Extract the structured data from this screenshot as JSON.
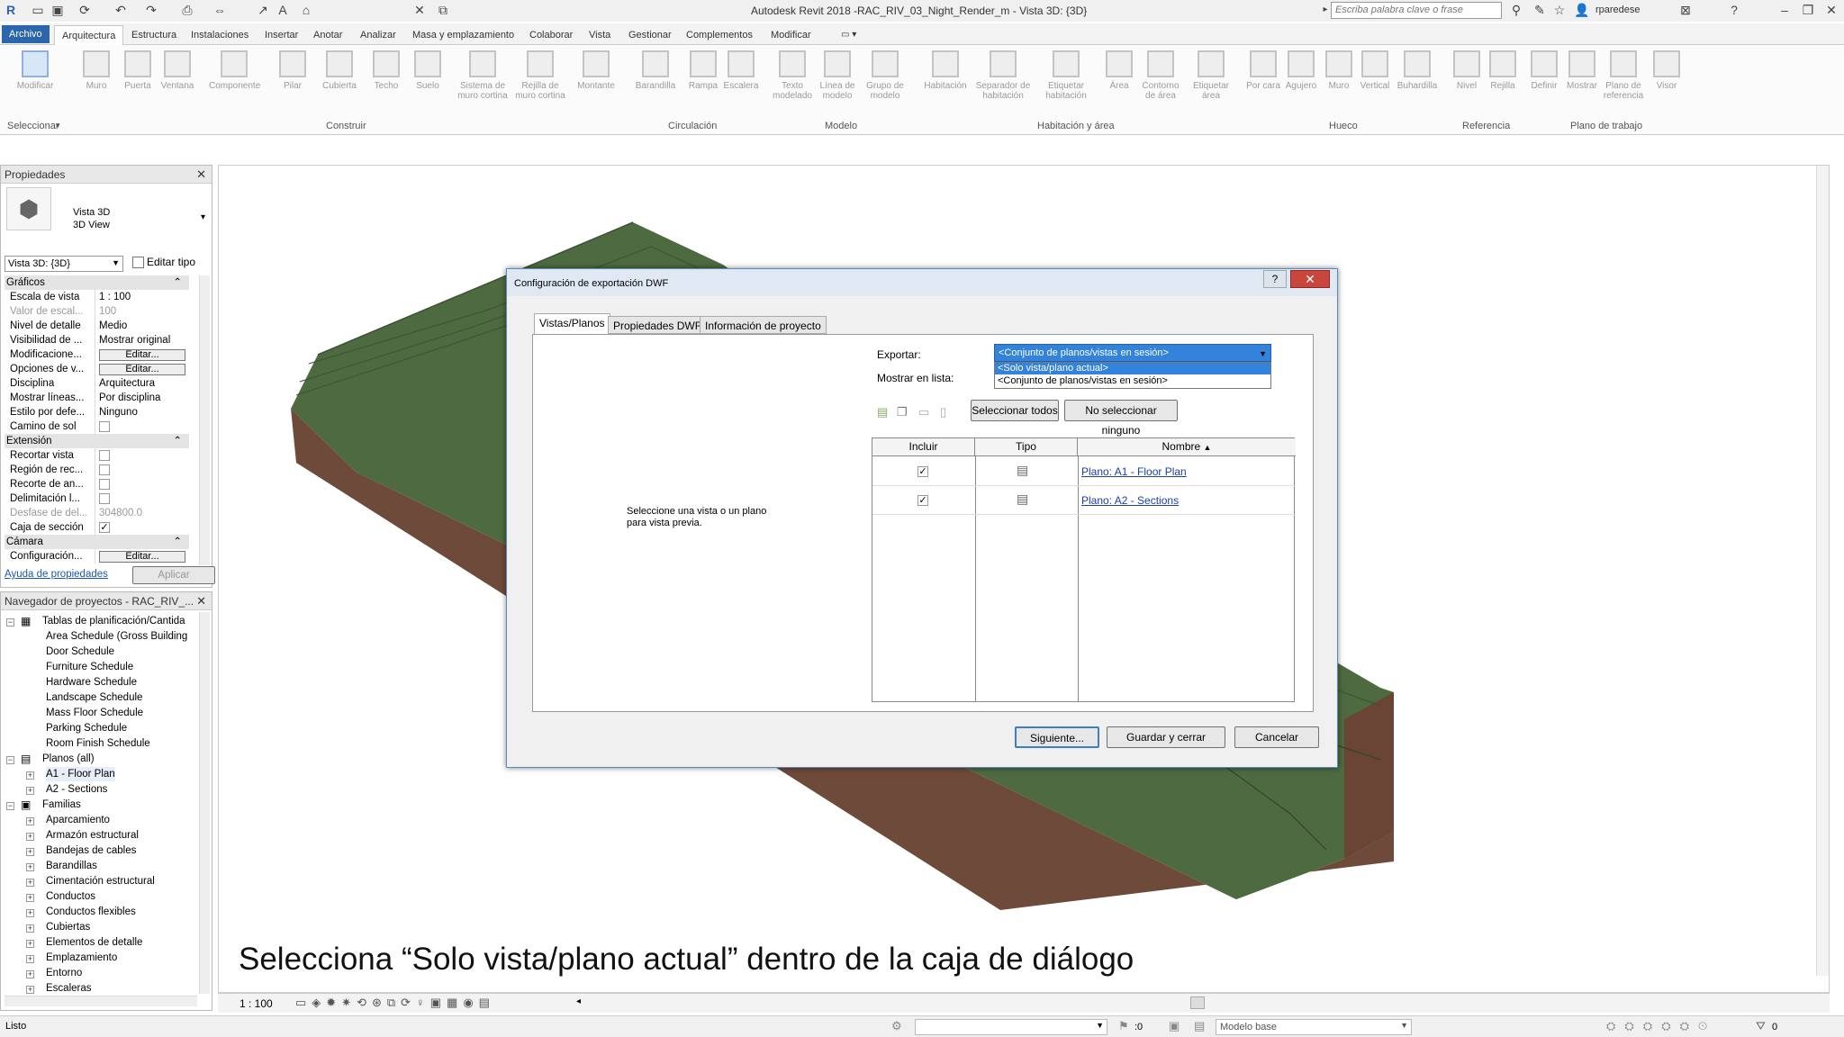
{
  "titlebar": {
    "app_title": "Autodesk Revit 2018 -",
    "doc_title": "RAC_RIV_03_Night_Render_m - Vista 3D: {3D}",
    "search_placeholder": "Escriba palabra clave o frase",
    "user": "rparedese"
  },
  "ribbon": {
    "tabs": [
      "Archivo",
      "Arquitectura",
      "Estructura",
      "Instalaciones",
      "Insertar",
      "Anotar",
      "Analizar",
      "Masa y emplazamiento",
      "Colaborar",
      "Vista",
      "Gestionar",
      "Complementos",
      "Modificar"
    ],
    "active_tab": "Arquitectura",
    "buttons": [
      "Modificar",
      "Muro",
      "Puerta",
      "Ventana",
      "Componente",
      "Pilar",
      "Cubierta",
      "Techo",
      "Suelo",
      "Sistema de muro cortina",
      "Rejilla de muro cortina",
      "Montante",
      "Barandilla",
      "Rampa",
      "Escalera",
      "Texto modelado",
      "Línea de modelo",
      "Grupo de modelo",
      "Habitación",
      "Separador de habitación",
      "Etiquetar habitación",
      "Área",
      "Contorno de área",
      "Etiquetar área",
      "Por cara",
      "Agujero",
      "Muro",
      "Vertical",
      "Buhardilla",
      "Nivel",
      "Rejilla",
      "Definir",
      "Mostrar",
      "Plano de referencia",
      "Visor"
    ],
    "panels": [
      "Seleccionar",
      "Construir",
      "Circulación",
      "Modelo",
      "Habitación y área",
      "Hueco",
      "Referencia",
      "Plano de trabajo"
    ]
  },
  "properties": {
    "title": "Propiedades",
    "type_name": "Vista 3D",
    "type_sub": "3D View",
    "selector": "Vista 3D: {3D}",
    "edit_type": "Editar tipo",
    "sections": {
      "graficos": "Gráficos",
      "extension": "Extensión",
      "camara": "Cámara"
    },
    "rows": {
      "escala": {
        "k": "Escala de vista",
        "v": "1 : 100"
      },
      "valor": {
        "k": "Valor de escal...",
        "v": "100"
      },
      "detalle": {
        "k": "Nivel de detalle",
        "v": "Medio"
      },
      "visib": {
        "k": "Visibilidad de ...",
        "v": "Mostrar original"
      },
      "modif": {
        "k": "Modificacione...",
        "v": "Editar..."
      },
      "opciones": {
        "k": "Opciones de v...",
        "v": "Editar..."
      },
      "disciplina": {
        "k": "Disciplina",
        "v": "Arquitectura"
      },
      "lineas": {
        "k": "Mostrar líneas...",
        "v": "Por disciplina"
      },
      "estilo": {
        "k": "Estilo por defe...",
        "v": "Ninguno"
      },
      "sol": {
        "k": "Camino de sol",
        "v": ""
      },
      "recortar": {
        "k": "Recortar vista",
        "v": ""
      },
      "region": {
        "k": "Región de rec...",
        "v": ""
      },
      "recorte": {
        "k": "Recorte de an...",
        "v": ""
      },
      "delim": {
        "k": "Delimitación l...",
        "v": ""
      },
      "desfase": {
        "k": "Desfase de del...",
        "v": "304800.0"
      },
      "caja": {
        "k": "Caja de sección",
        "v": ""
      },
      "config": {
        "k": "Configuración...",
        "v": "Editar..."
      }
    },
    "help_link": "Ayuda de propiedades",
    "apply": "Aplicar"
  },
  "navigator": {
    "title": "Navegador de proyectos - RAC_RIV_...",
    "items": [
      "Tablas de planificación/Cantida",
      "Area Schedule (Gross Building",
      "Door Schedule",
      "Furniture Schedule",
      "Hardware Schedule",
      "Landscape Schedule",
      "Mass Floor Schedule",
      "Parking Schedule",
      "Room Finish Schedule",
      "Planos (all)",
      "A1 - Floor Plan",
      "A2 - Sections",
      "Familias",
      "Aparcamiento",
      "Armazón estructural",
      "Bandejas de cables",
      "Barandillas",
      "Cimentación estructural",
      "Conductos",
      "Conductos flexibles",
      "Cubiertas",
      "Elementos de detalle",
      "Emplazamiento",
      "Entorno",
      "Escaleras"
    ]
  },
  "dialog": {
    "title": "Configuración de exportación DWF",
    "tabs": [
      "Vistas/Planos",
      "Propiedades DWF",
      "Información de proyecto"
    ],
    "export_label": "Exportar:",
    "export_value": "<Conjunto de planos/vistas en sesión>",
    "export_options": [
      "<Solo vista/plano actual>",
      "<Conjunto de planos/vistas en sesión>"
    ],
    "show_label": "Mostrar en lista:",
    "select_all": "Seleccionar todos",
    "select_none": "No seleccionar ninguno",
    "preview_text": "Seleccione una vista o un plano para vista previa.",
    "columns": [
      "Incluir",
      "Tipo",
      "Nombre"
    ],
    "rows": [
      {
        "included": true,
        "name": "Plano: A1 - Floor Plan"
      },
      {
        "included": true,
        "name": "Plano: A2 - Sections"
      }
    ],
    "next": "Siguiente...",
    "save_close": "Guardar y cerrar",
    "cancel": "Cancelar"
  },
  "viewbar": {
    "scale": "1 : 100"
  },
  "status": {
    "text": "Listo",
    "model": "Modelo base",
    "zero1": ":0",
    "zero2": "0"
  },
  "caption": "Selecciona “Solo vista/plano actual” dentro de la caja de diálogo",
  "colors": {
    "terrain_top": "#4e6a40",
    "terrain_side": "#6e4a3a",
    "selection": "#3383dc"
  }
}
